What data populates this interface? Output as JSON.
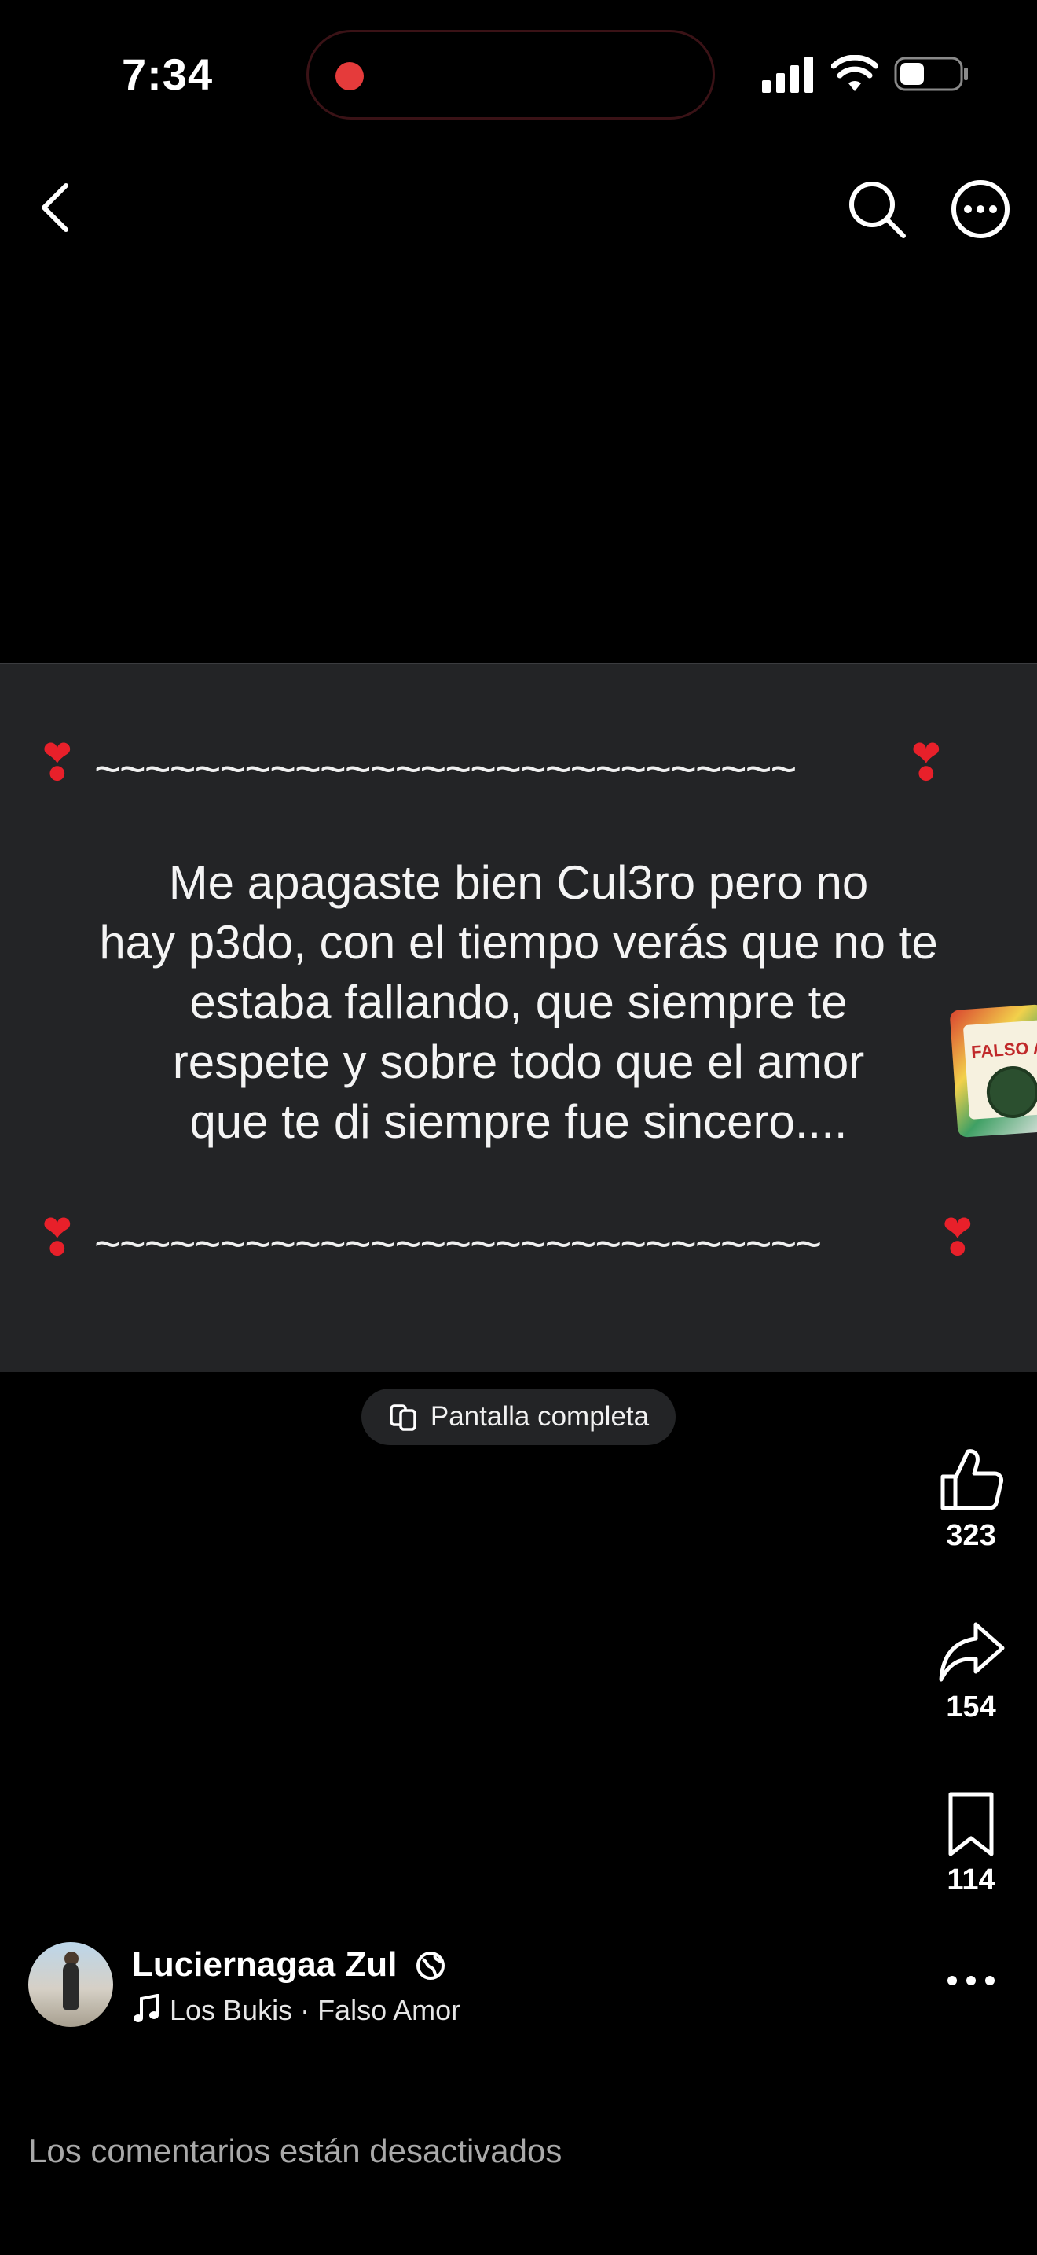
{
  "status_bar": {
    "time": "7:34"
  },
  "icons": {
    "back": "chevron-left-icon",
    "search": "search-icon",
    "more": "more-horizontal-icon",
    "like": "thumbs-up-icon",
    "share": "share-arrow-icon",
    "save": "bookmark-icon",
    "globe": "globe-icon",
    "music": "music-note-icon",
    "fullscreen": "fullscreen-icon"
  },
  "post": {
    "decor_top": "~~~~~~~~~~~~~~~~~~~~~~~~~~~~",
    "decor_bottom": "~~~~~~~~~~~~~~~~~~~~~~~~~~~~~",
    "heart": "❣",
    "text_lines": [
      "Me apagaste bien Cul3ro pero no",
      "hay p3do, con el tiempo verás que no te",
      "estaba fallando, que siempre te",
      "respete y sobre todo que el amor",
      "que te di siempre fue sincero...."
    ],
    "album_title": "FALSO AMOR"
  },
  "fullscreen_label": "Pantalla completa",
  "actions": {
    "likes": "323",
    "shares": "154",
    "saves": "114"
  },
  "author": {
    "name": "Luciernagaa Zul",
    "song": "Los Bukis · Falso Amor"
  },
  "comments_notice": "Los comentarios están desactivados",
  "colors": {
    "background": "#000000",
    "card": "#232426",
    "heart": "#e8202a",
    "record_dot": "#e53b3b"
  }
}
